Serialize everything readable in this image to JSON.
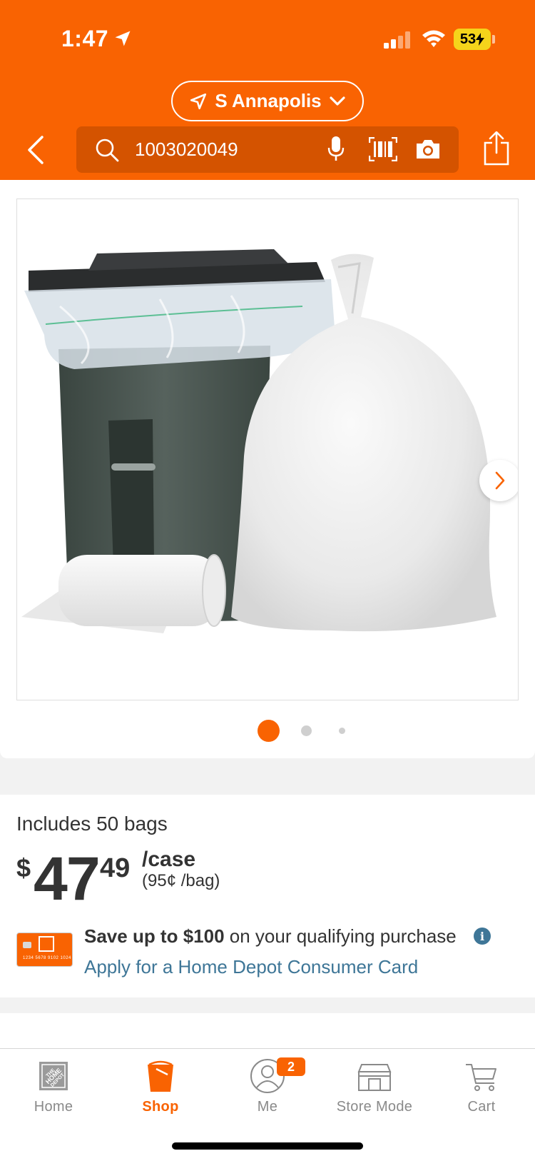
{
  "status_bar": {
    "time": "1:47",
    "battery": "53"
  },
  "header": {
    "store_name": "S Annapolis",
    "search_value": "1003020049",
    "brand_color": "#f96302"
  },
  "gallery": {
    "image_description_icon": "trash-can-with-bags-image",
    "page_count": 3,
    "active_page": 1
  },
  "pricing": {
    "includes": "Includes 50 bags",
    "currency_symbol": "$",
    "price_whole": "47",
    "price_cents": "49",
    "unit": "/case",
    "unit_price": "(95¢ /bag)"
  },
  "promo": {
    "save_bold": "Save up to $100",
    "save_rest": " on your qualifying purchase",
    "apply_link": "Apply for a Home Depot Consumer Card",
    "card_logo_text": "THE HOME DEPOT",
    "card_number": "1234 5678 9102 1024"
  },
  "tabbar": {
    "home": "Home",
    "shop": "Shop",
    "me": "Me",
    "me_badge": "2",
    "store_mode": "Store Mode",
    "cart": "Cart"
  }
}
